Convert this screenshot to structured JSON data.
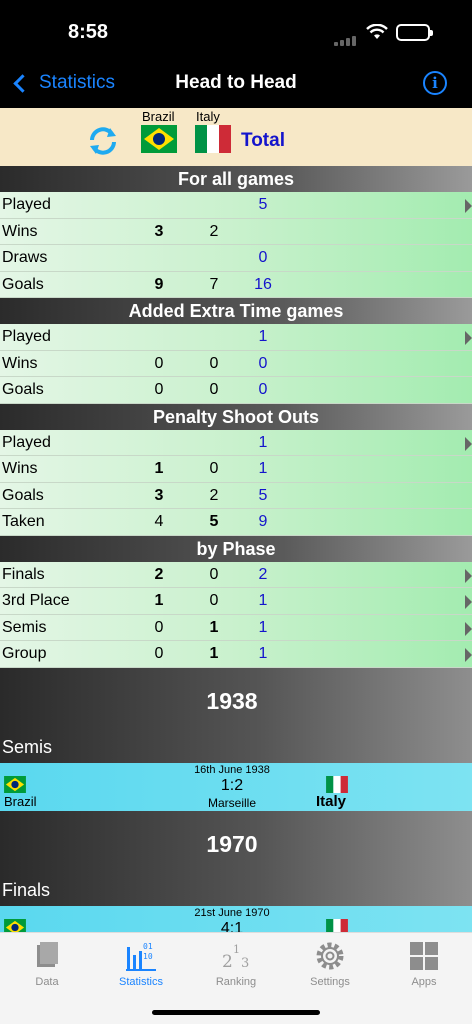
{
  "status": {
    "time": "8:58"
  },
  "nav": {
    "back_label": "Statistics",
    "title": "Head to Head",
    "info_icon": "i"
  },
  "teams": {
    "team_a": "Brazil",
    "team_b": "Italy",
    "total": "Total"
  },
  "sections": {
    "all_games": {
      "title": "For all games",
      "rows": [
        {
          "label": "Played",
          "a": "",
          "b": "",
          "t": "5"
        },
        {
          "label": "Wins",
          "a": "3",
          "b": "2",
          "t": ""
        },
        {
          "label": "Draws",
          "a": "",
          "b": "",
          "t": "0"
        },
        {
          "label": "Goals",
          "a": "9",
          "b": "7",
          "t": "16"
        }
      ]
    },
    "extra_time": {
      "title": "Added Extra Time games",
      "rows": [
        {
          "label": "Played",
          "a": "",
          "b": "",
          "t": "1"
        },
        {
          "label": "Wins",
          "a": "0",
          "b": "0",
          "t": "0"
        },
        {
          "label": "Goals",
          "a": "0",
          "b": "0",
          "t": "0"
        }
      ]
    },
    "penalties": {
      "title": "Penalty Shoot Outs",
      "rows": [
        {
          "label": "Played",
          "a": "",
          "b": "",
          "t": "1"
        },
        {
          "label": "Wins",
          "a": "1",
          "b": "0",
          "t": "1"
        },
        {
          "label": "Goals",
          "a": "3",
          "b": "2",
          "t": "5"
        },
        {
          "label": "Taken",
          "a": "4",
          "b": "5",
          "t": "9"
        }
      ]
    },
    "by_phase": {
      "title": "by Phase",
      "rows": [
        {
          "label": "Finals",
          "a": "2",
          "b": "0",
          "t": "2"
        },
        {
          "label": "3rd Place",
          "a": "1",
          "b": "0",
          "t": "1"
        },
        {
          "label": "Semis",
          "a": "0",
          "b": "1",
          "t": "1"
        },
        {
          "label": "Group",
          "a": "0",
          "b": "1",
          "t": "1"
        }
      ]
    }
  },
  "matches": [
    {
      "year": "1938",
      "phase": "Semis",
      "date": "16th June 1938",
      "score": "1:2",
      "venue": "Marseille",
      "team_a": "Brazil",
      "team_b": "Italy"
    },
    {
      "year": "1970",
      "phase": "Finals",
      "date": "21st June 1970",
      "score": "4:1",
      "venue": "",
      "team_a": "",
      "team_b": ""
    }
  ],
  "tabs": [
    {
      "label": "Data",
      "icon": "data-icon"
    },
    {
      "label": "Statistics",
      "icon": "statistics-icon"
    },
    {
      "label": "Ranking",
      "icon": "ranking-icon"
    },
    {
      "label": "Settings",
      "icon": "gear-icon"
    },
    {
      "label": "Apps",
      "icon": "apps-icon"
    }
  ],
  "colors": {
    "accent": "#1a84ff",
    "total": "#1414cc",
    "row_green": "#a3ecb0",
    "match_cyan": "#5ad8ef",
    "team_header": "#f7e8c7"
  }
}
